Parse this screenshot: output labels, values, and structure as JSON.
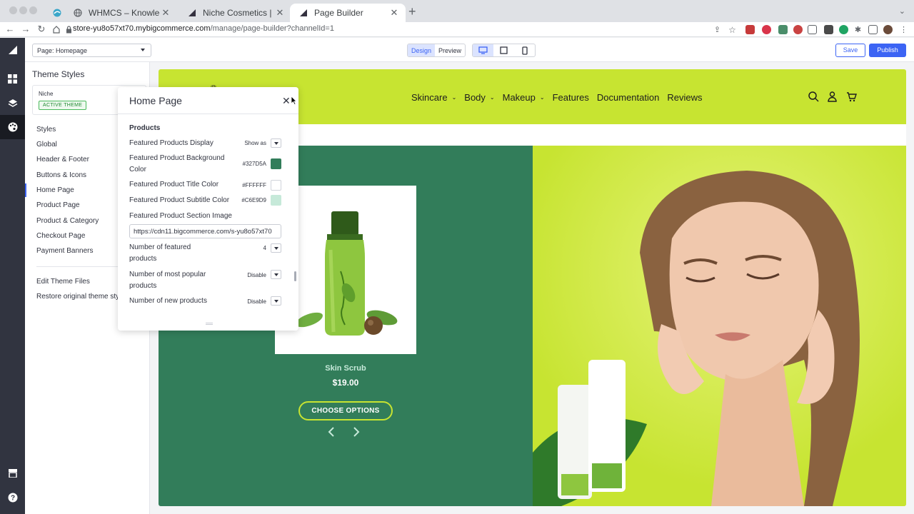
{
  "browser": {
    "tabs": [
      {
        "title": "",
        "icon": "site-favicon"
      },
      {
        "title": "WHMCS – Knowledgebase",
        "icon": "globe-icon"
      },
      {
        "title": "Niche Cosmetics | BigCommerce",
        "icon": "bigcommerce-icon"
      },
      {
        "title": "Page Builder",
        "icon": "bigcommerce-icon"
      }
    ],
    "url_host": "store-yu8o57xt70.mybigcommerce.com",
    "url_path": "/manage/page-builder?channelId=1"
  },
  "toolbar": {
    "page_select": "Page: Homepage",
    "design_label": "Design",
    "preview_label": "Preview",
    "save_label": "Save",
    "publish_label": "Publish"
  },
  "sidebar": {
    "title": "Theme Styles",
    "theme_name": "Niche",
    "theme_badge": "ACTIVE THEME",
    "items": [
      "Styles",
      "Global",
      "Header & Footer",
      "Buttons & Icons",
      "Home Page",
      "Product Page",
      "Product & Category",
      "Checkout Page",
      "Payment Banners"
    ],
    "active_item": "Home Page",
    "extra_items": [
      "Edit Theme Files",
      "Restore original theme styles"
    ]
  },
  "panel": {
    "title": "Home Page",
    "section": "Products",
    "rows": {
      "display_label": "Featured Products Display",
      "display_value": "Show as",
      "bg_label": "Featured Product Background Color",
      "bg_value": "#327D5A",
      "title_color_label": "Featured Product Title Color",
      "title_color_value": "#FFFFFF",
      "subtitle_color_label": "Featured Product Subtitle Color",
      "subtitle_color_value": "#C6E9D9",
      "image_label": "Featured Product Section Image",
      "image_value": "https://cdn11.bigcommerce.com/s-yu8o57xt70",
      "num_featured_label": "Number of featured products",
      "num_featured_value": "4",
      "most_popular_label": "Number of most popular products",
      "most_popular_value": "Disable",
      "new_products_label": "Number of new products",
      "new_products_value": "Disable"
    }
  },
  "store": {
    "nav": [
      "Skincare",
      "Body",
      "Makeup",
      "Features",
      "Documentation",
      "Reviews"
    ],
    "nav_has_dropdown": [
      true,
      true,
      true,
      false,
      false,
      false
    ],
    "product_name": "Skin Scrub",
    "product_price": "$19.00",
    "cta": "CHOOSE OPTIONS"
  },
  "colors": {
    "accent": "#3C64F4",
    "header_green": "#C7E431",
    "featured_bg": "#327D5A",
    "subtitle": "#C6E9D9",
    "title": "#FFFFFF",
    "rail": "#313440"
  }
}
